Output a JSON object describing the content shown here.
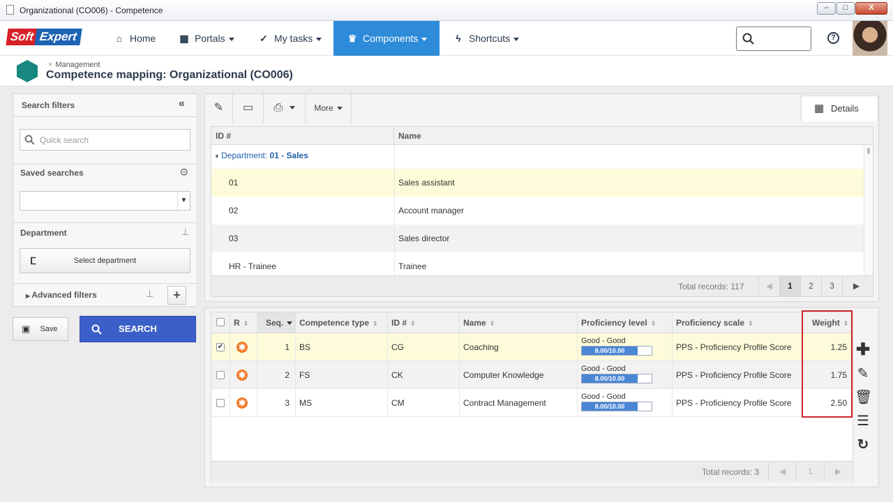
{
  "window": {
    "title": "Organizational (CO006) - Competence",
    "min": "–",
    "max": "□",
    "close": "X"
  },
  "nav": {
    "logo_soft": "Soft",
    "logo_expert": "Expert",
    "items": [
      {
        "label": "Home",
        "icon": "home-icon"
      },
      {
        "label": "Portals",
        "icon": "grid-icon"
      },
      {
        "label": "My tasks",
        "icon": "check-icon"
      },
      {
        "label": "Components",
        "icon": "trophy-icon"
      },
      {
        "label": "Shortcuts",
        "icon": "bolt-icon"
      }
    ],
    "help": "?"
  },
  "header": {
    "breadcrumb": "Management",
    "title": "Competence mapping: Organizational (CO006)"
  },
  "filters": {
    "title": "Search filters",
    "quick_search_placeholder": "Quick search",
    "saved_searches": "Saved searches",
    "department": "Department",
    "select_department": "Select department",
    "advanced_filters": "Advanced filters",
    "save": "Save",
    "search": "SEARCH"
  },
  "toolbar": {
    "more": "More",
    "details": "Details"
  },
  "top_grid": {
    "columns": [
      "ID #",
      "Name"
    ],
    "group_label": "Department:",
    "group_value": "01 - Sales",
    "rows": [
      {
        "id": "01",
        "name": "Sales assistant"
      },
      {
        "id": "02",
        "name": "Account manager"
      },
      {
        "id": "03",
        "name": "Sales director"
      },
      {
        "id": "HR - Trainee",
        "name": "Trainee"
      }
    ],
    "total": "Total records: 117",
    "pages": [
      "1",
      "2",
      "3"
    ],
    "current_page": "1"
  },
  "bottom_grid": {
    "columns": [
      "R",
      "Seq.",
      "Competence type",
      "ID #",
      "Name",
      "Proficiency level",
      "Proficiency scale",
      "Weight"
    ],
    "rows": [
      {
        "seq": "1",
        "type": "BS",
        "id": "CG",
        "name": "Coaching",
        "level": "Good - Good",
        "score": "8.00/10.00",
        "fill": 0.8,
        "scale": "PPS - Proficiency Profile Score",
        "weight": "1.25",
        "checked": true
      },
      {
        "seq": "2",
        "type": "FS",
        "id": "CK",
        "name": "Computer Knowledge",
        "level": "Good - Good",
        "score": "8.00/10.00",
        "fill": 0.8,
        "scale": "PPS - Proficiency Profile Score",
        "weight": "1.75",
        "checked": false
      },
      {
        "seq": "3",
        "type": "MS",
        "id": "CM",
        "name": "Contract Management",
        "level": "Good - Good",
        "score": "8.00/10.00",
        "fill": 0.8,
        "scale": "PPS - Proficiency Profile Score",
        "weight": "2.50",
        "checked": false
      }
    ],
    "total": "Total records: 3",
    "page": "1"
  },
  "colors": {
    "accent": "#2d8bd9",
    "search_button": "#3b5fc9",
    "highlight": "#d0242b",
    "selected_row": "#fdfbd9"
  }
}
